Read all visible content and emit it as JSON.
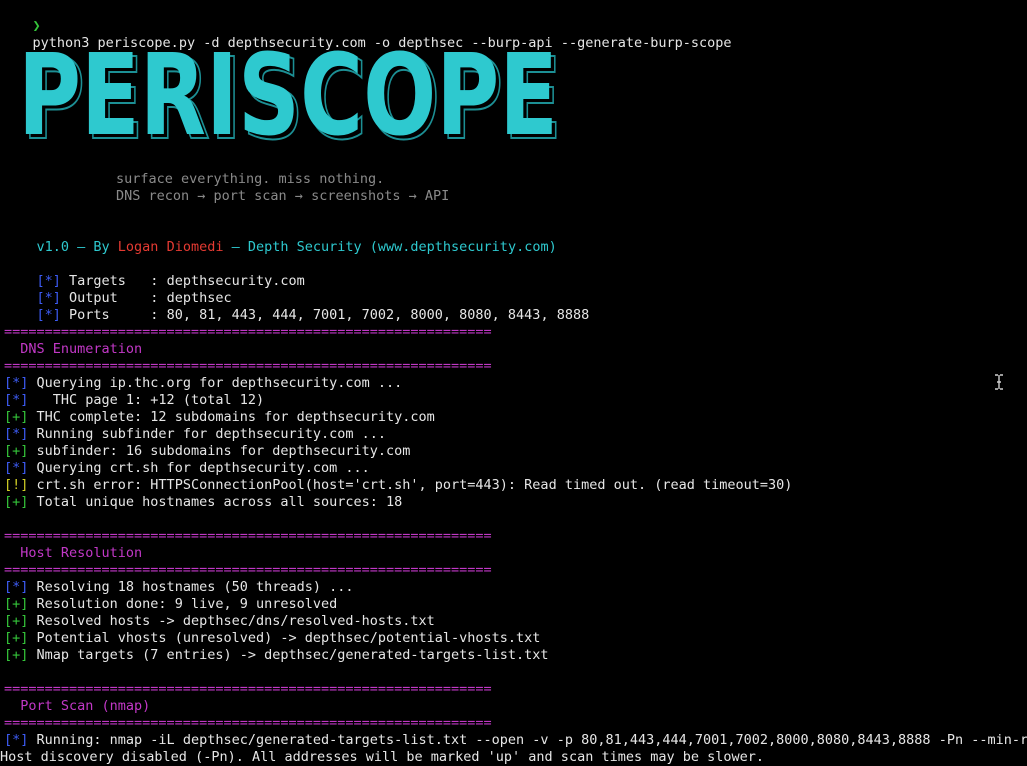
{
  "command": {
    "prompt_symbol": "❯",
    "text": "python3 periscope.py -d depthsecurity.com -o depthsec --burp-api --generate-burp-scope"
  },
  "banner": {
    "art_text": "PERISCOPE",
    "tagline_1": "surface everything. miss nothing.",
    "tagline_2": "DNS recon → port scan → screenshots → API"
  },
  "version_line": {
    "prefix": "v1.0 — By ",
    "author": "Logan Diomedi",
    "suffix": " — Depth Security (www.depthsecurity.com)"
  },
  "config": [
    {
      "tag": "[*]",
      "text": " Targets   : depthsecurity.com"
    },
    {
      "tag": "[*]",
      "text": " Output    : depthsec"
    },
    {
      "tag": "[*]",
      "text": " Ports     : 80, 81, 443, 444, 7001, 7002, 8000, 8080, 8443, 8888"
    }
  ],
  "separator": "============================================================",
  "sections": {
    "dns": {
      "title": "  DNS Enumeration",
      "lines": [
        {
          "tag": "[*]",
          "color": "blue",
          "text": " Querying ip.thc.org for depthsecurity.com ..."
        },
        {
          "tag": "[*]",
          "color": "blue",
          "text": "   THC page 1: +12 (total 12)"
        },
        {
          "tag": "[+]",
          "color": "green",
          "text": " THC complete: 12 subdomains for depthsecurity.com"
        },
        {
          "tag": "[*]",
          "color": "blue",
          "text": " Running subfinder for depthsecurity.com ..."
        },
        {
          "tag": "[+]",
          "color": "green",
          "text": " subfinder: 16 subdomains for depthsecurity.com"
        },
        {
          "tag": "[*]",
          "color": "blue",
          "text": " Querying crt.sh for depthsecurity.com ..."
        },
        {
          "tag": "[!]",
          "color": "yellow",
          "text": " crt.sh error: HTTPSConnectionPool(host='crt.sh', port=443): Read timed out. (read timeout=30)"
        },
        {
          "tag": "[+]",
          "color": "green",
          "text": " Total unique hostnames across all sources: 18"
        }
      ]
    },
    "host": {
      "title": "  Host Resolution",
      "lines": [
        {
          "tag": "[*]",
          "color": "blue",
          "text": " Resolving 18 hostnames (50 threads) ..."
        },
        {
          "tag": "[+]",
          "color": "green",
          "text": " Resolution done: 9 live, 9 unresolved"
        },
        {
          "tag": "[+]",
          "color": "green",
          "text": " Resolved hosts -> depthsec/dns/resolved-hosts.txt"
        },
        {
          "tag": "[+]",
          "color": "green",
          "text": " Potential vhosts (unresolved) -> depthsec/potential-vhosts.txt"
        },
        {
          "tag": "[+]",
          "color": "green",
          "text": " Nmap targets (7 entries) -> depthsec/generated-targets-list.txt"
        }
      ]
    },
    "portscan": {
      "title": "  Port Scan (nmap)",
      "lines": [
        {
          "tag": "[*]",
          "color": "blue",
          "text": " Running: nmap -iL depthsec/generated-targets-list.txt --open -v -p 80,81,443,444,7001,7002,8000,8080,8443,8888 -Pn --min-rat"
        }
      ],
      "plain_line": "Host discovery disabled (-Pn). All addresses will be marked 'up' and scan times may be slower."
    }
  },
  "colors": {
    "background": "#000000",
    "cyan": "#2ec9cf",
    "blue": "#3d5cf5",
    "green": "#35c53a",
    "yellow": "#d3d026",
    "red": "#e43a32",
    "magenta": "#c238c7"
  }
}
